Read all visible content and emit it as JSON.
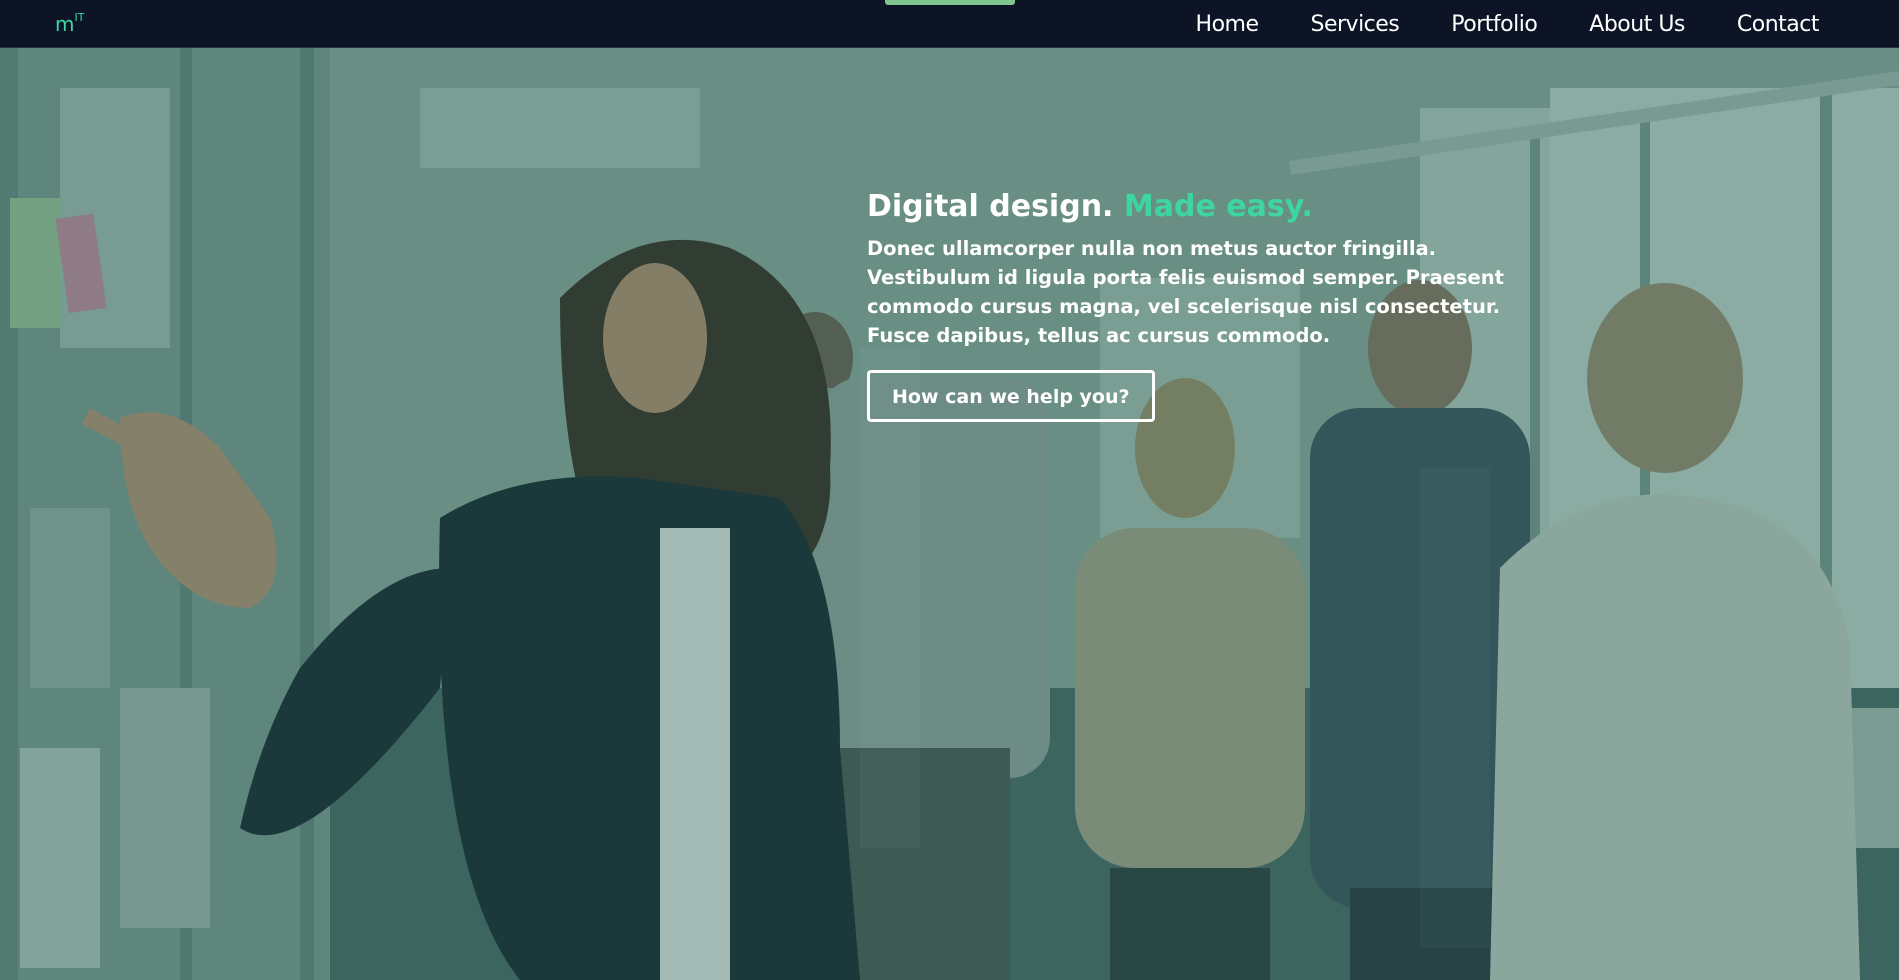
{
  "brand": {
    "logo_main": "m",
    "logo_sup": "IT",
    "accent_color": "#3dd6a0"
  },
  "nav": {
    "items": [
      {
        "label": "Home"
      },
      {
        "label": "Services"
      },
      {
        "label": "Portfolio"
      },
      {
        "label": "About Us"
      },
      {
        "label": "Contact"
      }
    ]
  },
  "hero": {
    "headline_main": "Digital design.",
    "headline_accent": "Made easy.",
    "lead": "Donec ullamcorper nulla non metus auctor fringilla. Vestibulum id ligula porta felis euismod semper. Praesent commodo cursus magna, vel scelerisque nisl consectetur. Fusce dapibus, tellus ac cursus commodo.",
    "cta_label": "How can we help you?",
    "background_image": "office-team-photo"
  }
}
